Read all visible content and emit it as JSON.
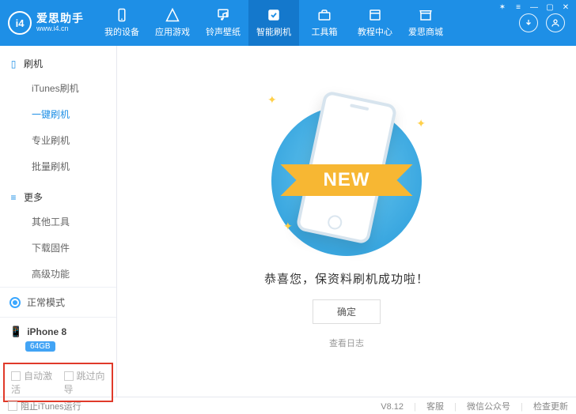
{
  "logo": {
    "badge": "i4",
    "name": "爱思助手",
    "url": "www.i4.cn"
  },
  "tabs": [
    {
      "label": "我的设备",
      "icon": "device"
    },
    {
      "label": "应用游戏",
      "icon": "apps"
    },
    {
      "label": "铃声壁纸",
      "icon": "music"
    },
    {
      "label": "智能刷机",
      "icon": "flash",
      "active": true
    },
    {
      "label": "工具箱",
      "icon": "toolbox"
    },
    {
      "label": "教程中心",
      "icon": "book"
    },
    {
      "label": "爱思商城",
      "icon": "store"
    }
  ],
  "sidebar": {
    "group_flash": "刷机",
    "flash_items": [
      "iTunes刷机",
      "一键刷机",
      "专业刷机",
      "批量刷机"
    ],
    "flash_active_index": 1,
    "group_more": "更多",
    "more_items": [
      "其他工具",
      "下载固件",
      "高级功能"
    ],
    "mode_label": "正常模式",
    "device_name": "iPhone 8",
    "device_storage": "64GB",
    "auto_activate": "自动激活",
    "skip_wizard": "跳过向导"
  },
  "main": {
    "ribbon": "NEW",
    "message": "恭喜您，保资料刷机成功啦！",
    "ok": "确定",
    "viewlog": "查看日志"
  },
  "statusbar": {
    "prevent_itunes": "阻止iTunes运行",
    "version": "V8.12",
    "support": "客服",
    "wechat": "微信公众号",
    "update": "检查更新"
  }
}
